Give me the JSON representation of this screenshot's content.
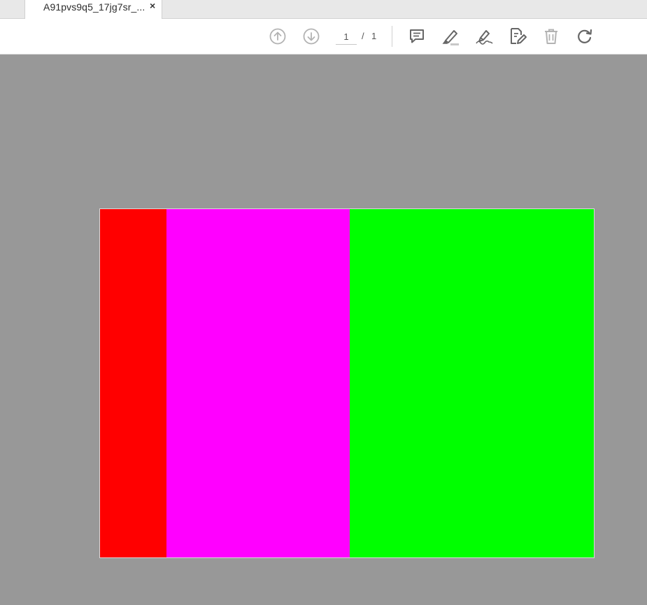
{
  "tab": {
    "title": "A91pvs9q5_17jg7sr_...",
    "close_glyph": "×"
  },
  "toolbar": {
    "prev_icon": "arrow-up-circle-icon",
    "next_icon": "arrow-down-circle-icon",
    "page_current": "1",
    "page_separator": "/",
    "page_total": "1",
    "tools": [
      "comment-icon",
      "highlight-icon",
      "fill-sign-icon",
      "edit-pdf-icon",
      "trash-icon",
      "rotate-icon"
    ]
  },
  "document": {
    "stripes": [
      {
        "name": "red",
        "color": "#ff0000",
        "share": 0.1345
      },
      {
        "name": "magenta",
        "color": "#ff00ff",
        "share": 0.3706
      },
      {
        "name": "green",
        "color": "#00ff00",
        "share": 0.4949
      }
    ]
  }
}
